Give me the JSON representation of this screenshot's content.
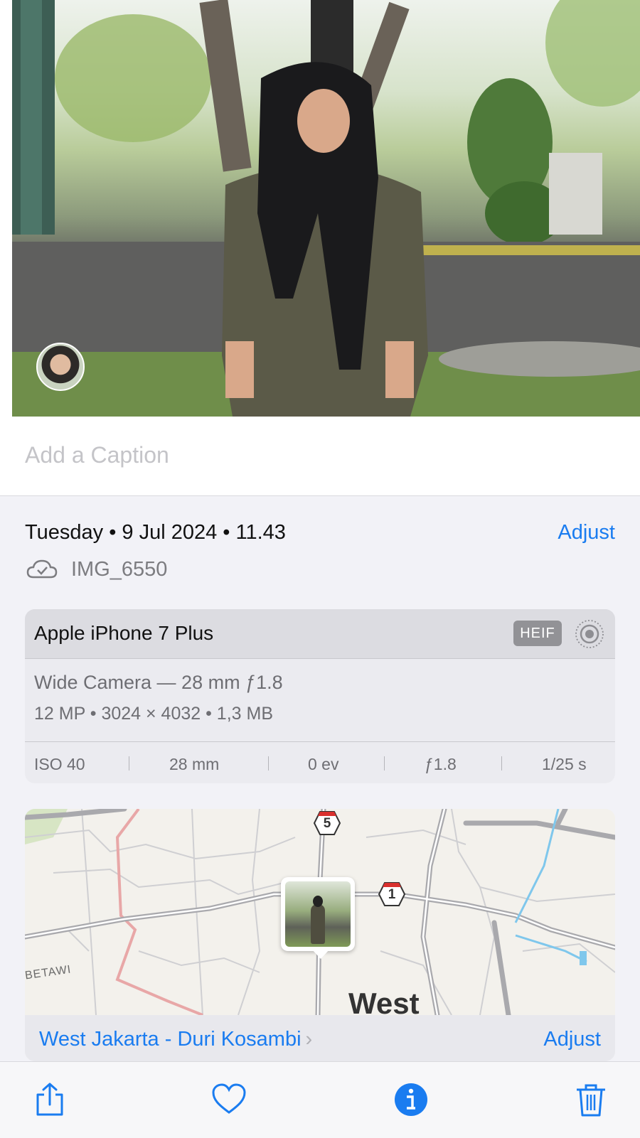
{
  "photo": {
    "subject": "person-portrait-photo",
    "avatar": "face-avatar"
  },
  "caption": {
    "placeholder": "Add a Caption",
    "value": ""
  },
  "info": {
    "datetime": "Tuesday • 9 Jul 2024 • 11.43",
    "adjust_label": "Adjust",
    "filename": "IMG_6550",
    "cloud_icon": "icloud-synced-icon"
  },
  "camera": {
    "device": "Apple iPhone 7 Plus",
    "format_badge": "HEIF",
    "live_icon": "live-photo-icon",
    "lens": "Wide Camera — 28 mm ƒ1.8",
    "specs": "12 MP  •  3024 × 4032  •  1,3 MB",
    "exif": {
      "iso": "ISO 40",
      "focal": "28 mm",
      "ev": "0 ev",
      "aperture": "ƒ1.8",
      "shutter": "1/25 s"
    }
  },
  "map": {
    "shield_5": "5",
    "shield_1": "1",
    "region_label": "West",
    "area_label": "BETAWI",
    "location": "West Jakarta - Duri Kosambi",
    "adjust_label": "Adjust"
  },
  "toolbar": {
    "share": "share-icon",
    "favorite": "heart-icon",
    "info": "info-icon",
    "delete": "trash-icon"
  },
  "colors": {
    "accent": "#1a7cf0",
    "background": "#f2f2f7"
  }
}
